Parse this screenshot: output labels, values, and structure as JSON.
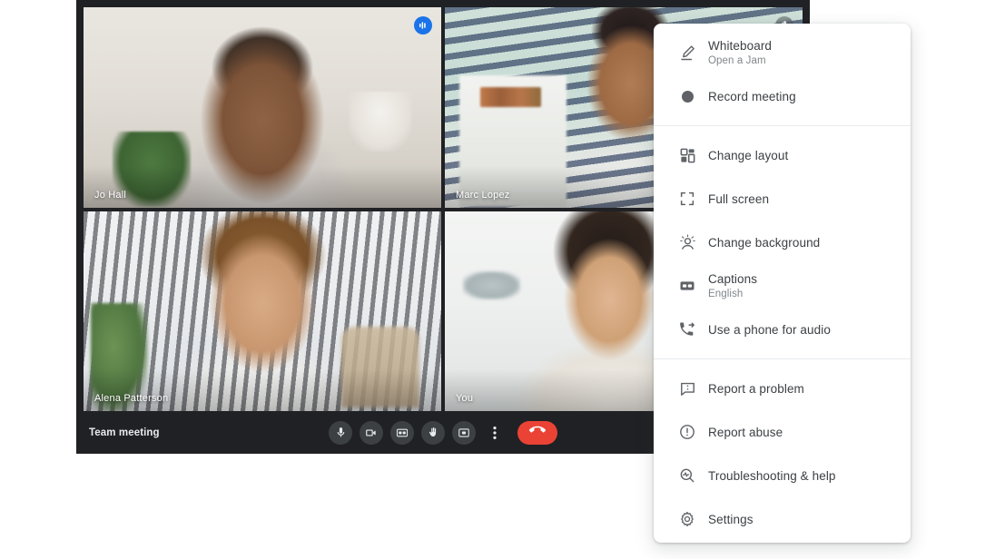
{
  "app": {
    "window_background": "#202124",
    "accent_color": "#4285f4",
    "hangup_color": "#ea4335",
    "meeting_title": "Team meeting"
  },
  "video_grid": {
    "tiles": [
      {
        "name": "Jo Hall",
        "active_speaker": true,
        "badge": "speaking-indicator-icon",
        "position": "top-left"
      },
      {
        "name": "Marc Lopez",
        "active_speaker": false,
        "badge": "mic-muted-icon",
        "position": "top-right"
      },
      {
        "name": "Alena Patterson",
        "active_speaker": false,
        "badge": null,
        "position": "bottom-left"
      },
      {
        "name": "You",
        "active_speaker": false,
        "badge": null,
        "position": "bottom-right"
      }
    ]
  },
  "control_bar": {
    "title": "Team meeting",
    "controls": [
      {
        "name": "microphone-button",
        "icon": "microphone-icon"
      },
      {
        "name": "camera-button",
        "icon": "video-camera-icon"
      },
      {
        "name": "captions-button",
        "icon": "closed-captions-icon"
      },
      {
        "name": "raise-hand-button",
        "icon": "raised-hand-icon"
      },
      {
        "name": "present-screen-button",
        "icon": "present-screen-icon"
      },
      {
        "name": "more-options-button",
        "icon": "more-vertical-icon"
      },
      {
        "name": "leave-call-button",
        "icon": "hangup-phone-icon"
      }
    ]
  },
  "overflow_menu": {
    "sections": [
      {
        "items": [
          {
            "label": "Whiteboard",
            "sublabel": "Open a Jam",
            "icon": "pen-icon"
          },
          {
            "label": "Record meeting",
            "sublabel": null,
            "icon": "record-dot-icon"
          }
        ]
      },
      {
        "items": [
          {
            "label": "Change layout",
            "sublabel": null,
            "icon": "layout-grid-icon"
          },
          {
            "label": "Full screen",
            "sublabel": null,
            "icon": "fullscreen-icon"
          },
          {
            "label": "Change background",
            "sublabel": null,
            "icon": "change-background-icon"
          },
          {
            "label": "Captions",
            "sublabel": "English",
            "icon": "closed-captions-icon"
          },
          {
            "label": "Use a phone for audio",
            "sublabel": null,
            "icon": "phone-forward-icon"
          }
        ]
      },
      {
        "items": [
          {
            "label": "Report a problem",
            "sublabel": null,
            "icon": "feedback-icon"
          },
          {
            "label": "Report abuse",
            "sublabel": null,
            "icon": "exclamation-circle-icon"
          },
          {
            "label": "Troubleshooting & help",
            "sublabel": null,
            "icon": "troubleshoot-icon"
          },
          {
            "label": "Settings",
            "sublabel": null,
            "icon": "gear-icon"
          }
        ]
      }
    ]
  }
}
